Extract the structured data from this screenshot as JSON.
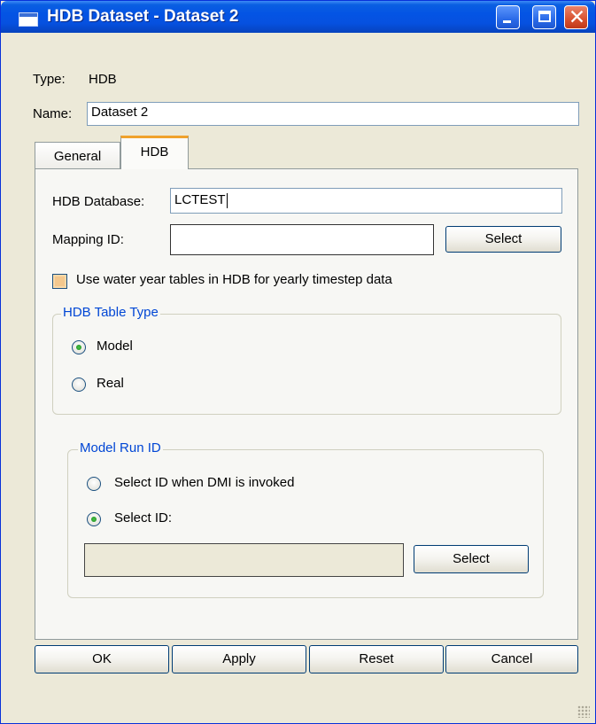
{
  "window": {
    "title": "HDB Dataset - Dataset 2",
    "colors": {
      "title_bar": "#0454e4",
      "close_button": "#d8502e",
      "window_bg": "#ece9d8",
      "group_title": "#0046d5",
      "active_tab_accent": "#f0a22c"
    }
  },
  "fields": {
    "type_label": "Type:",
    "type_value": "HDB",
    "name_label": "Name:",
    "name_value": "Dataset 2"
  },
  "tabs": [
    {
      "label": "General",
      "active": false
    },
    {
      "label": "HDB",
      "active": true
    }
  ],
  "hdb": {
    "database_label": "HDB Database:",
    "database_value": "LCTEST",
    "mapping_label": "Mapping ID:",
    "mapping_value": "",
    "mapping_select": "Select",
    "water_year_label": "Use water year tables in HDB for yearly timestep data",
    "water_year_checked": false,
    "table_type": {
      "title": "HDB Table Type",
      "options": [
        {
          "label": "Model",
          "selected": true
        },
        {
          "label": "Real",
          "selected": false
        }
      ]
    },
    "model_run": {
      "title": "Model Run ID",
      "options": [
        {
          "label": "Select ID when DMI is invoked",
          "selected": false
        },
        {
          "label": "Select ID:",
          "selected": true
        }
      ],
      "id_value": "",
      "select": "Select"
    }
  },
  "buttons": {
    "ok": "OK",
    "apply": "Apply",
    "reset": "Reset",
    "cancel": "Cancel"
  },
  "icons": [
    "window-icon",
    "minimize-icon",
    "maximize-icon",
    "close-icon",
    "resize-grip-icon"
  ]
}
